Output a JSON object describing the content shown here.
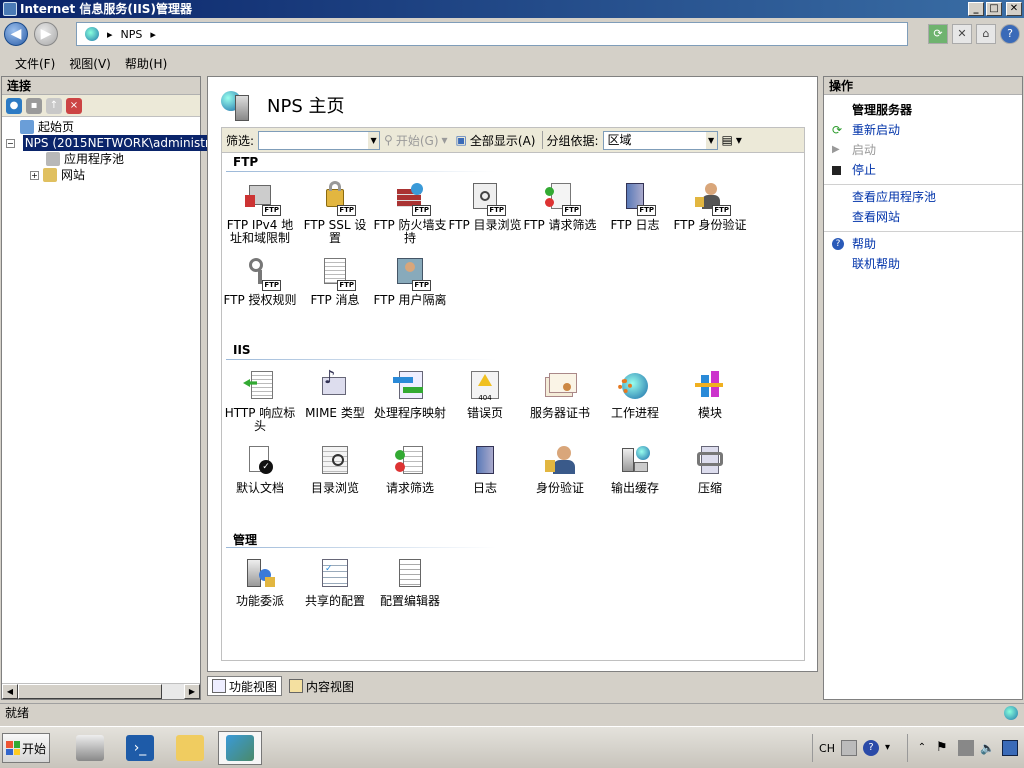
{
  "window": {
    "title": "Internet 信息服务(IIS)管理器"
  },
  "titlebar_buttons": [
    "_",
    "□",
    "✕"
  ],
  "address": {
    "back_glyph": "◀",
    "forward_glyph": "▶",
    "crumbs": [
      "NPS"
    ],
    "sep": "▸",
    "end": "▸"
  },
  "toolbar_right": {
    "refresh": "⟳",
    "stop": "✕",
    "home": "⌂",
    "help": "?"
  },
  "menu": [
    "文件(F)",
    "视图(V)",
    "帮助(H)"
  ],
  "connections": {
    "header": "连接",
    "tree": [
      {
        "label": "起始页",
        "indent": 0,
        "expander": ""
      },
      {
        "label": "NPS (2015NETWORK\\administr",
        "indent": 0,
        "expander": "−",
        "selected": true
      },
      {
        "label": "应用程序池",
        "indent": 1,
        "expander": ""
      },
      {
        "label": "网站",
        "indent": 1,
        "expander": "+"
      }
    ]
  },
  "main": {
    "title": "NPS 主页",
    "filter_label": "筛选:",
    "filter_value": "",
    "go_label": "开始(G)",
    "show_all_label": "全部显示(A)",
    "group_by_label": "分组依据:",
    "group_by_value": "区域",
    "sections": [
      {
        "name": "FTP",
        "items": [
          {
            "label": "FTP IPv4 地址和域限制",
            "icon": "ftp-ip-restrict-icon"
          },
          {
            "label": "FTP SSL 设置",
            "icon": "ftp-ssl-icon"
          },
          {
            "label": "FTP 防火墙支持",
            "icon": "ftp-firewall-icon"
          },
          {
            "label": "FTP 目录浏览",
            "icon": "ftp-dir-browse-icon"
          },
          {
            "label": "FTP 请求筛选",
            "icon": "ftp-request-filter-icon"
          },
          {
            "label": "FTP 日志",
            "icon": "ftp-log-icon"
          },
          {
            "label": "FTP 身份验证",
            "icon": "ftp-auth-icon"
          },
          {
            "label": "FTP 授权规则",
            "icon": "ftp-authz-icon"
          },
          {
            "label": "FTP 消息",
            "icon": "ftp-message-icon"
          },
          {
            "label": "FTP 用户隔离",
            "icon": "ftp-user-isolation-icon"
          }
        ]
      },
      {
        "name": "IIS",
        "items": [
          {
            "label": "HTTP 响应标头",
            "icon": "http-headers-icon"
          },
          {
            "label": "MIME 类型",
            "icon": "mime-icon"
          },
          {
            "label": "处理程序映射",
            "icon": "handler-mapping-icon"
          },
          {
            "label": "错误页",
            "icon": "error-page-icon"
          },
          {
            "label": "服务器证书",
            "icon": "server-cert-icon"
          },
          {
            "label": "工作进程",
            "icon": "worker-process-icon"
          },
          {
            "label": "模块",
            "icon": "modules-icon"
          },
          {
            "label": "默认文档",
            "icon": "default-doc-icon"
          },
          {
            "label": "目录浏览",
            "icon": "dir-browse-icon"
          },
          {
            "label": "请求筛选",
            "icon": "request-filter-icon"
          },
          {
            "label": "日志",
            "icon": "log-icon"
          },
          {
            "label": "身份验证",
            "icon": "auth-icon"
          },
          {
            "label": "输出缓存",
            "icon": "output-cache-icon"
          },
          {
            "label": "压缩",
            "icon": "compression-icon"
          }
        ]
      },
      {
        "name": "管理",
        "items": [
          {
            "label": "功能委派",
            "icon": "feature-delegation-icon"
          },
          {
            "label": "共享的配置",
            "icon": "shared-config-icon"
          },
          {
            "label": "配置编辑器",
            "icon": "config-editor-icon"
          }
        ]
      }
    ],
    "tabs": [
      "功能视图",
      "内容视图"
    ]
  },
  "actions": {
    "header": "操作",
    "groups": [
      {
        "title": "管理服务器",
        "items": [
          {
            "label": "重新启动",
            "enabled": true,
            "icon": "restart-icon"
          },
          {
            "label": "启动",
            "enabled": false,
            "icon": "start-icon"
          },
          {
            "label": "停止",
            "enabled": true,
            "icon": "stop-icon"
          }
        ]
      },
      {
        "title": "",
        "items": [
          {
            "label": "查看应用程序池",
            "enabled": true,
            "icon": ""
          },
          {
            "label": "查看网站",
            "enabled": true,
            "icon": ""
          }
        ]
      },
      {
        "title": "",
        "items": [
          {
            "label": "帮助",
            "enabled": true,
            "icon": "help-icon"
          },
          {
            "label": "联机帮助",
            "enabled": true,
            "icon": ""
          }
        ]
      }
    ]
  },
  "status": {
    "text": "就绪"
  },
  "taskbar": {
    "start_label": "开始",
    "apps": [
      "server-manager-icon",
      "powershell-icon",
      "explorer-icon",
      "iis-manager-icon"
    ],
    "tray_lang": "CH"
  },
  "colors": {
    "selection": "#0a246a",
    "link": "#0033aa",
    "title_gradient_start": "#0a246a"
  }
}
